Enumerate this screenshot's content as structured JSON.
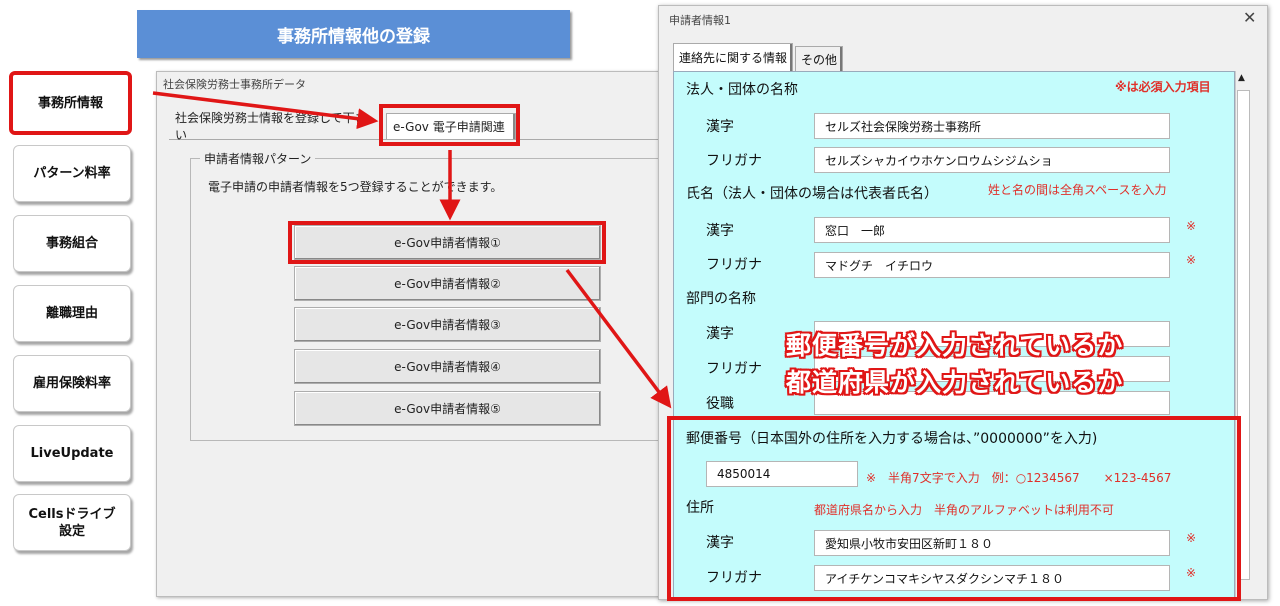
{
  "banner": {
    "title": "事務所情報他の登録"
  },
  "nav": {
    "items": [
      {
        "label": "事務所情報"
      },
      {
        "label": "パターン料率"
      },
      {
        "label": "事務組合"
      },
      {
        "label": "離職理由"
      },
      {
        "label": "雇用保険料率"
      },
      {
        "label": "LiveUpdate"
      },
      {
        "label_line1": "Cellsドライブ",
        "label_line2": "設定"
      }
    ]
  },
  "window1": {
    "title": "社会保険労務士事務所データ",
    "tabs": [
      {
        "label": "社会保険労務士情報を登録して下さい"
      },
      {
        "label": "e-Gov 電子申請関連"
      }
    ],
    "group_label": "申請者情報パターン",
    "description": "電子申請の申請者情報を5つ登録することができます。",
    "buttons": [
      {
        "label": "e-Gov申請者情報①"
      },
      {
        "label": "e-Gov申請者情報②"
      },
      {
        "label": "e-Gov申請者情報③"
      },
      {
        "label": "e-Gov申請者情報④"
      },
      {
        "label": "e-Gov申請者情報⑤"
      }
    ]
  },
  "window2": {
    "title": "申請者情報1",
    "close": "✕",
    "tabs": [
      {
        "label": "連絡先に関する情報"
      },
      {
        "label": "その他"
      }
    ],
    "required_note": "※は必須入力項目",
    "corp": {
      "heading": "法人・団体の名称",
      "kanji_label": "漢字",
      "kanji_value": "セルズ社会保険労務士事務所",
      "kana_label": "フリガナ",
      "kana_value": "セルズシャカイウホケンロウムシジムショ"
    },
    "name": {
      "heading": "氏名（法人・団体の場合は代表者氏名）",
      "note": "姓と名の間は全角スペースを入力",
      "kanji_label": "漢字",
      "kanji_value": "窓口　一郎",
      "kana_label": "フリガナ",
      "kana_value": "マドグチ　イチロウ",
      "req_mark": "※"
    },
    "dept": {
      "heading": "部門の名称",
      "kanji_label": "漢字",
      "kana_label": "フリガナ",
      "title_label": "役職"
    },
    "postal": {
      "heading": "郵便番号（日本国外の住所を入力する場合は、”0000000”を入力)",
      "value": "4850014",
      "note": "※　半角7文字で入力　例：○1234567　　×123-4567"
    },
    "address": {
      "heading": "住所",
      "note": "都道府県名から入力　半角のアルファベットは利用不可",
      "kanji_label": "漢字",
      "kanji_value": "愛知県小牧市安田区新町１８０",
      "kana_label": "フリガナ",
      "kana_value": "アイチケンコマキシヤスダクシンマチ１８０",
      "req_mark": "※"
    }
  },
  "callout": {
    "line1": "郵便番号が入力されているか",
    "line2": "都道府県が入力されているか"
  },
  "colors": {
    "highlight": "#e01616",
    "banner": "#5b8fd6",
    "panel": "#c4fcfc"
  }
}
